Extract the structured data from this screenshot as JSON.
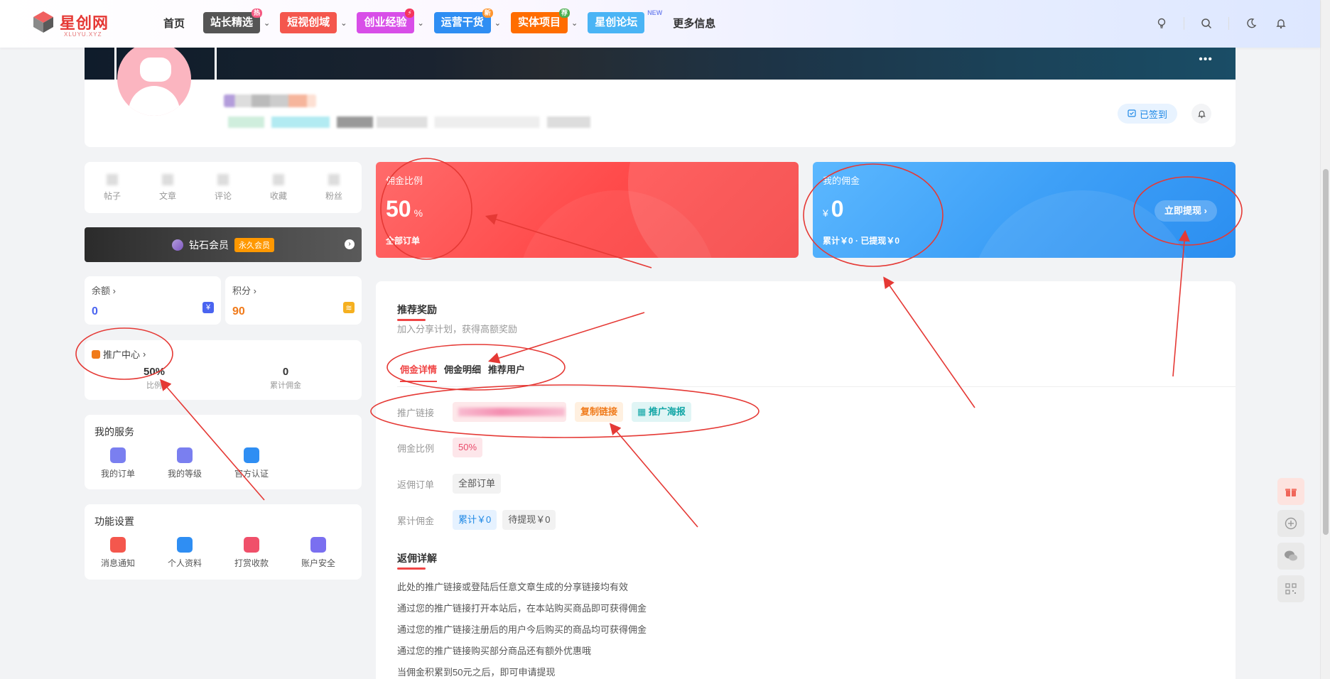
{
  "header": {
    "logo_text": "星创网",
    "logo_sub": "XLUYU.XYZ",
    "nav": [
      {
        "label": "首页",
        "style": "plain"
      },
      {
        "label": "站长精选",
        "style": "pill",
        "color": "#555555",
        "badge": "热",
        "badge_color": "#f55a82",
        "caret": true
      },
      {
        "label": "短视创域",
        "style": "pill",
        "color": "#f4574d",
        "caret": true
      },
      {
        "label": "创业经验",
        "style": "pill",
        "color": "#d84ee8",
        "badge": "⚡",
        "badge_color": "#f5365c",
        "caret": true
      },
      {
        "label": "运营干货",
        "style": "pill",
        "color": "#2f8ef3",
        "badge": "新",
        "badge_color": "#ff9630",
        "caret": true
      },
      {
        "label": "实体项目",
        "style": "pill",
        "color": "#ff6d00",
        "badge": "荐",
        "badge_color": "#4caf50",
        "caret": true
      },
      {
        "label": "星创论坛",
        "style": "pill",
        "color": "#4ab4f5",
        "new": "NEW"
      },
      {
        "label": "更多信息",
        "style": "plain"
      }
    ],
    "icons": [
      "lightbulb-icon",
      "search-icon",
      "moon-icon",
      "bell-icon"
    ]
  },
  "profile": {
    "signed_label": "已签到"
  },
  "stats": [
    {
      "label": "帖子"
    },
    {
      "label": "文章"
    },
    {
      "label": "评论"
    },
    {
      "label": "收藏"
    },
    {
      "label": "粉丝"
    }
  ],
  "vip": {
    "label": "钻石会员",
    "tag": "永久会员"
  },
  "balance": {
    "title": "余额",
    "value": "0",
    "color": "#4a64f0"
  },
  "points": {
    "title": "积分",
    "value": "90",
    "color": "#f07a1a"
  },
  "promo": {
    "title": "推广中心",
    "rate_value": "50%",
    "rate_label": "比例",
    "commission_value": "0",
    "commission_label": "累计佣金"
  },
  "services": {
    "title": "我的服务",
    "items": [
      {
        "label": "我的订单",
        "icon": "clipboard-icon",
        "color": "#7a7ff0"
      },
      {
        "label": "我的等级",
        "icon": "chart-icon",
        "color": "#7a7ff0"
      },
      {
        "label": "官方认证",
        "icon": "verified-icon",
        "color": "#2f8ef3"
      }
    ]
  },
  "functions": {
    "title": "功能设置",
    "items": [
      {
        "label": "消息通知",
        "icon": "bell-icon",
        "color": "#f4574d"
      },
      {
        "label": "个人资料",
        "icon": "user-card-icon",
        "color": "#2f8ef3"
      },
      {
        "label": "打赏收款",
        "icon": "gift-icon",
        "color": "#f0506a"
      },
      {
        "label": "账户安全",
        "icon": "shield-icon",
        "color": "#7a6ff0"
      }
    ]
  },
  "rate_card": {
    "label": "佣金比例",
    "value": "50",
    "unit": "%",
    "sub": "全部订单"
  },
  "wallet_card": {
    "label": "我的佣金",
    "currency": "¥",
    "value": "0",
    "total": "累计￥0",
    "withdrawn": "已提现￥0",
    "button": "立即提现"
  },
  "reward": {
    "title": "推荐奖励",
    "subtitle": "加入分享计划，获得高额奖励",
    "tabs": [
      "佣金详情",
      "佣金明细",
      "推荐用户"
    ],
    "link_label": "推广链接",
    "copy_button": "复制链接",
    "poster_button": "推广海报",
    "rate_label": "佣金比例",
    "rate_value": "50%",
    "order_label": "返佣订单",
    "order_value": "全部订单",
    "total_label": "累计佣金",
    "total_value": "累计￥0",
    "pending_value": "待提现￥0",
    "detail_title": "返佣详解",
    "details": [
      "此处的推广链接或登陆后任意文章生成的分享链接均有效",
      "通过您的推广链接打开本站后，在本站购买商品即可获得佣金",
      "通过您的推广链接注册后的用户今后购买的商品均可获得佣金",
      "通过您的推广链接购买部分商品还有额外优惠哦",
      "当佣金积累到50元之后，即可申请提现"
    ]
  },
  "floating": [
    "gift-icon",
    "plus-circle-icon",
    "wechat-icon",
    "qrcode-icon"
  ]
}
